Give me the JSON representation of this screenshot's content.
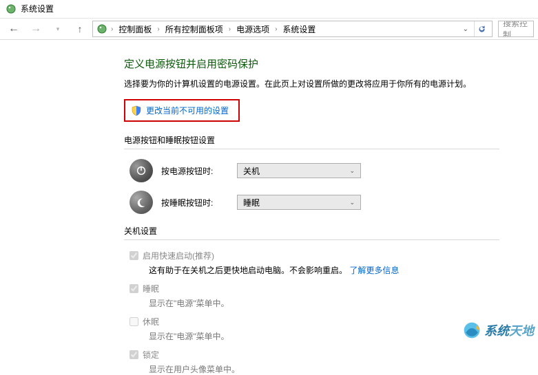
{
  "window": {
    "title": "系统设置"
  },
  "nav": {
    "crumbs": [
      "控制面板",
      "所有控制面板项",
      "电源选项",
      "系统设置"
    ],
    "search_placeholder": "搜索控制"
  },
  "main": {
    "heading": "定义电源按钮并启用密码保护",
    "description": "选择要为你的计算机设置的电源设置。在此页上对设置所做的更改将应用于你所有的电源计划。",
    "change_unavailable": "更改当前不可用的设置",
    "sections": {
      "buttons_title": "电源按钮和睡眠按钮设置",
      "power_button_label": "按电源按钮时:",
      "power_button_value": "关机",
      "sleep_button_label": "按睡眠按钮时:",
      "sleep_button_value": "睡眠",
      "shutdown_title": "关机设置",
      "fast_startup": {
        "label": "启用快速启动(推荐)",
        "desc_prefix": "这有助于在关机之后更快地启动电脑。不会影响重启。",
        "desc_link": "了解更多信息"
      },
      "sleep": {
        "label": "睡眠",
        "desc": "显示在\"电源\"菜单中。"
      },
      "hibernate": {
        "label": "休眠",
        "desc": "显示在\"电源\"菜单中。"
      },
      "lock": {
        "label": "锁定",
        "desc": "显示在用户头像菜单中。"
      }
    }
  },
  "watermark": {
    "text1": "系统",
    "text2": "天地"
  }
}
